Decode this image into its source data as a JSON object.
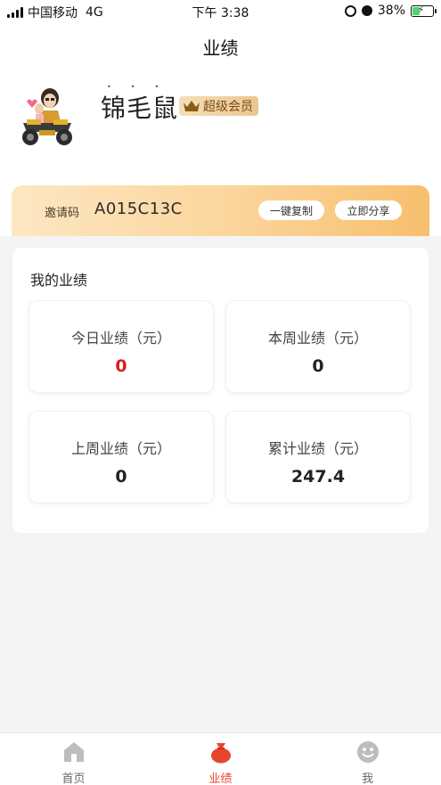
{
  "status_bar": {
    "carrier": "中国移动",
    "network": "4G",
    "time": "下午 3:38",
    "battery": "38%",
    "battery_level": 0.38
  },
  "header": {
    "title": "业绩"
  },
  "profile": {
    "name": "锦毛鼠",
    "member_level": "超级会员"
  },
  "invite": {
    "label": "邀请码",
    "code": "A015C13C",
    "copy_label": "一键复制",
    "share_label": "立即分享"
  },
  "performance": {
    "title": "我的业绩",
    "stats": [
      {
        "label": "今日业绩（元）",
        "value": "0"
      },
      {
        "label": "本周业绩（元）",
        "value": "0"
      },
      {
        "label": "上周业绩（元）",
        "value": "0"
      },
      {
        "label": "累计业绩（元）",
        "value": "247.4"
      }
    ]
  },
  "tabbar": {
    "items": [
      {
        "label": "首页",
        "icon": "home-icon"
      },
      {
        "label": "业绩",
        "icon": "money-bag-icon"
      },
      {
        "label": "我",
        "icon": "smiley-icon"
      }
    ],
    "active_index": 1
  },
  "colors": {
    "accent": "#e8452f",
    "highlight_value": "#d81e1e",
    "invite_gradient_start": "#fde7c3",
    "invite_gradient_end": "#f7bf6d",
    "vip_text": "#7a4a12"
  }
}
